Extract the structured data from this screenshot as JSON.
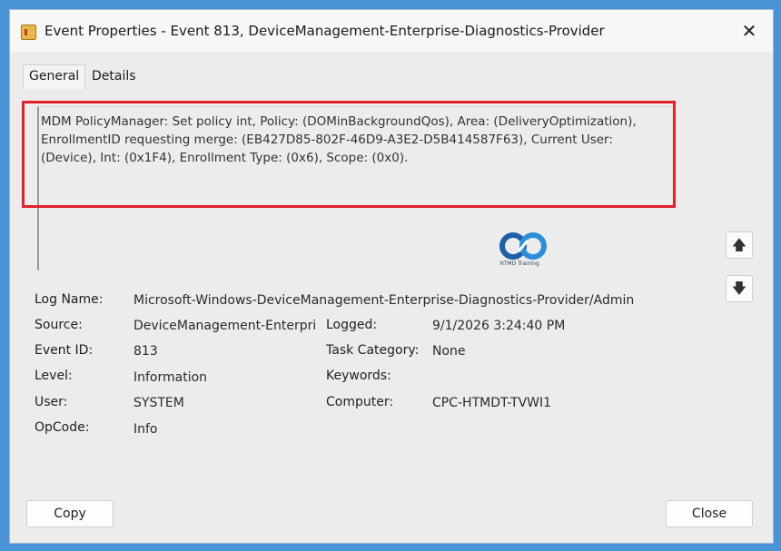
{
  "window": {
    "title": "Event Properties - Event 813, DeviceManagement-Enterprise-Diagnostics-Provider",
    "close_glyph": "✕"
  },
  "tabs": [
    {
      "label": "General",
      "selected": true
    },
    {
      "label": "Details",
      "selected": false
    }
  ],
  "description": "MDM PolicyManager: Set policy int, Policy: (DOMinBackgroundQos), Area: (DeliveryOptimization), EnrollmentID requesting merge: (EB427D85-802F-46D9-A3E2-D5B414587F63), Current User: (Device), Int: (0x1F4), Enrollment Type: (0x6), Scope: (0x0).",
  "watermark": {
    "caption": "HTMD Training"
  },
  "fields": {
    "log_name": {
      "label": "Log Name:",
      "value": "Microsoft-Windows-DeviceManagement-Enterprise-Diagnostics-Provider/Admin"
    },
    "source": {
      "label": "Source:",
      "value": "DeviceManagement-Enterpri"
    },
    "logged": {
      "label": "Logged:",
      "value": "9/1/2026 3:24:40 PM"
    },
    "event_id": {
      "label": "Event ID:",
      "value": "813"
    },
    "task_category": {
      "label": "Task Category:",
      "value": "None"
    },
    "level": {
      "label": "Level:",
      "value": "Information"
    },
    "keywords": {
      "label": "Keywords:",
      "value": ""
    },
    "user": {
      "label": "User:",
      "value": "SYSTEM"
    },
    "computer": {
      "label": "Computer:",
      "value": "CPC-HTMDT-TVWI1"
    },
    "opcode": {
      "label": "OpCode:",
      "value": "Info"
    }
  },
  "buttons": {
    "copy": "Copy",
    "close": "Close"
  },
  "colors": {
    "highlight": "#e3212b",
    "background": "#4a93d6"
  }
}
